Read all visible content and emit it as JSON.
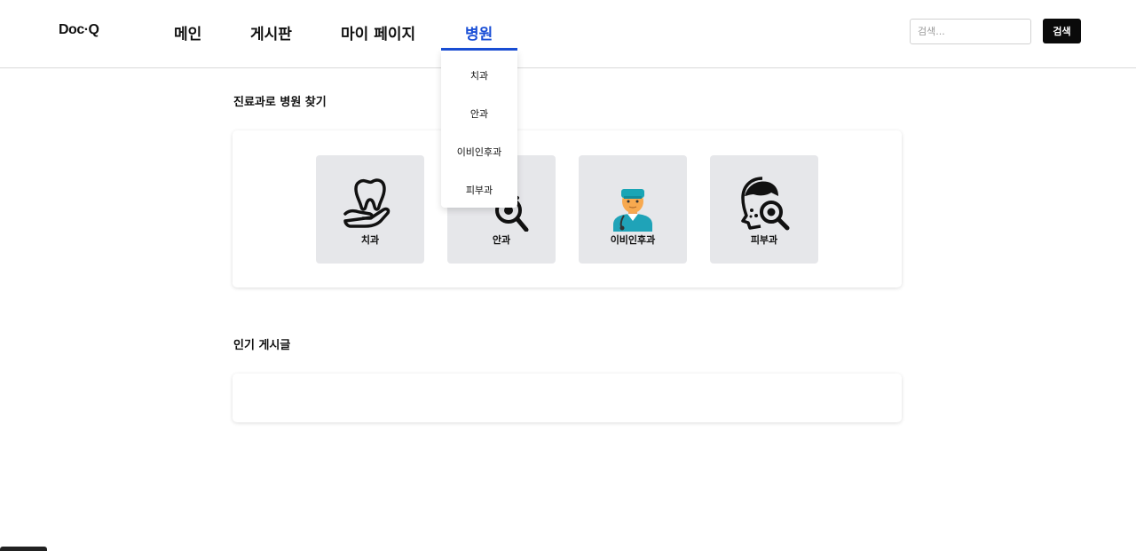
{
  "header": {
    "logo": "Doc·Q",
    "nav": [
      {
        "label": "메인"
      },
      {
        "label": "게시판"
      },
      {
        "label": "마이 페이지"
      },
      {
        "label": "병원"
      }
    ],
    "search": {
      "placeholder": "검색...",
      "value": "",
      "button_label": "검색"
    }
  },
  "dropdown": {
    "items": [
      {
        "label": "치과"
      },
      {
        "label": "안과"
      },
      {
        "label": "이비인후과"
      },
      {
        "label": "피부과"
      }
    ]
  },
  "departments": {
    "title": "진료과로 병원 찾기",
    "items": [
      {
        "label": "치과",
        "icon": "tooth-in-hand-icon"
      },
      {
        "label": "안과",
        "icon": "eye-magnifier-icon"
      },
      {
        "label": "이비인후과",
        "icon": "doctor-icon"
      },
      {
        "label": "피부과",
        "icon": "skin-magnifier-icon"
      }
    ]
  },
  "popular": {
    "title": "인기 게시글"
  },
  "colors": {
    "accent": "#1a4fd6",
    "tile_bg": "#e6e7ea",
    "button_bg": "#0a0a0a"
  }
}
